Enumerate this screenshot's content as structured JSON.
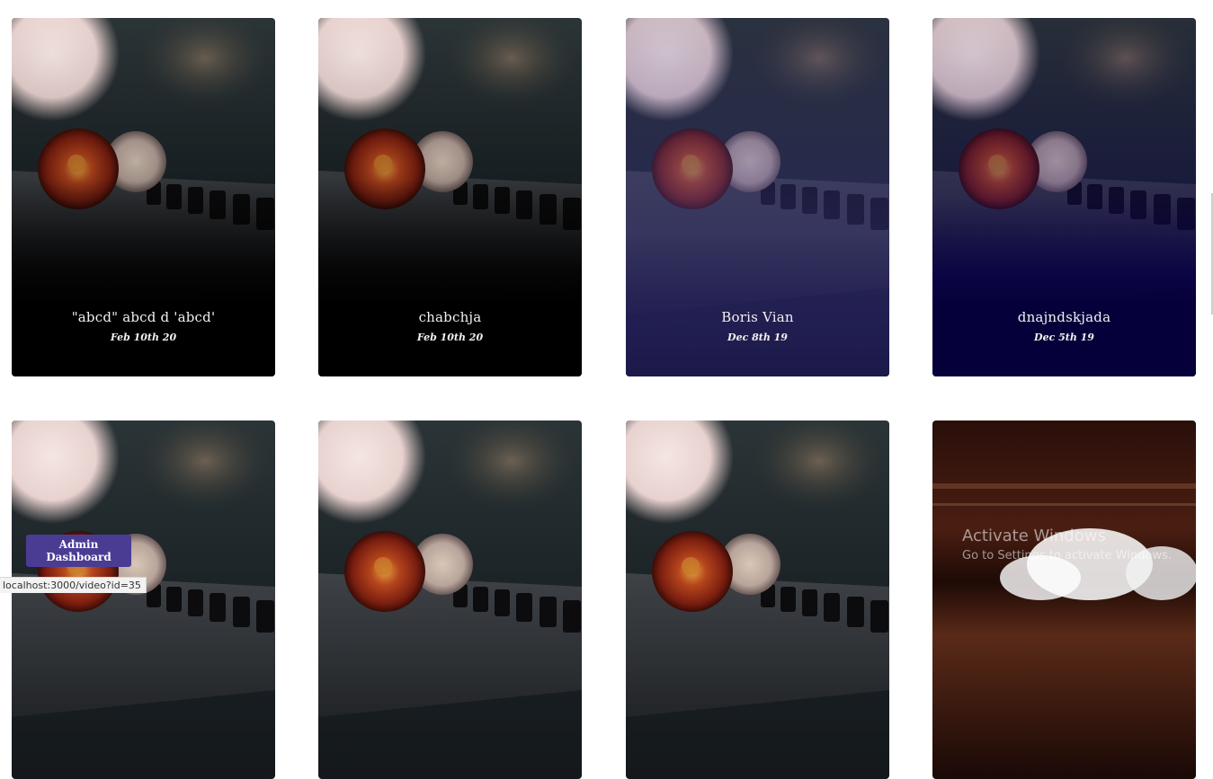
{
  "cards": [
    {
      "title": "\"abcd\" abcd d 'abcd'",
      "date": "Feb 10th 20",
      "tint": "black"
    },
    {
      "title": "chabchja",
      "date": "Feb 10th 20",
      "tint": "black"
    },
    {
      "title": "Boris Vian",
      "date": "Dec 8th 19",
      "tint": "purple"
    },
    {
      "title": "dnajndskjada",
      "date": "Dec 5th 19",
      "tint": "navy"
    },
    {
      "title": "",
      "date": "",
      "tint": "none"
    },
    {
      "title": "",
      "date": "",
      "tint": "none"
    },
    {
      "title": "",
      "date": "",
      "tint": "none"
    },
    {
      "title": "",
      "date": "",
      "tint": "none"
    }
  ],
  "admin_button": {
    "label": "Admin Dashboard"
  },
  "status_bar": {
    "url": "localhost:3000/video?id=35"
  },
  "watermark": {
    "title": "Activate Windows",
    "subtitle": "Go to Settings to activate Windows."
  },
  "colors": {
    "button": "#4b3c93",
    "tint_black": "#000000",
    "tint_purple": "#1c1a4a",
    "tint_navy": "#06003a"
  }
}
